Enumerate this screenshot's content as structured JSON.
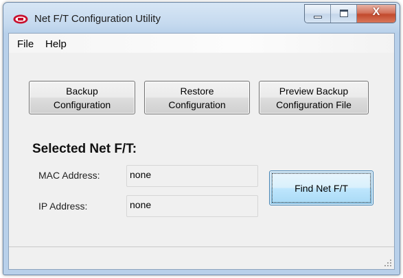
{
  "window": {
    "title": "Net F/T Configuration Utility",
    "close_glyph": "X"
  },
  "menu": {
    "file": "File",
    "help": "Help"
  },
  "buttons": {
    "backup": "Backup\nConfiguration",
    "restore": "Restore\nConfiguration",
    "preview": "Preview Backup\nConfiguration File",
    "find": "Find Net F/T"
  },
  "selected": {
    "heading": "Selected Net F/T:",
    "mac_label": "MAC Address:",
    "mac_value": "none",
    "ip_label": "IP Address:",
    "ip_value": "none"
  },
  "icons": {
    "app": "ati-logo-icon",
    "minimize": "minimize-icon",
    "maximize": "maximize-icon",
    "close": "close-icon",
    "grip": "resize-grip-icon"
  },
  "colors": {
    "accent": "#3c7fb1",
    "close_red": "#c24a2d",
    "frame": "#b8d0ea"
  }
}
